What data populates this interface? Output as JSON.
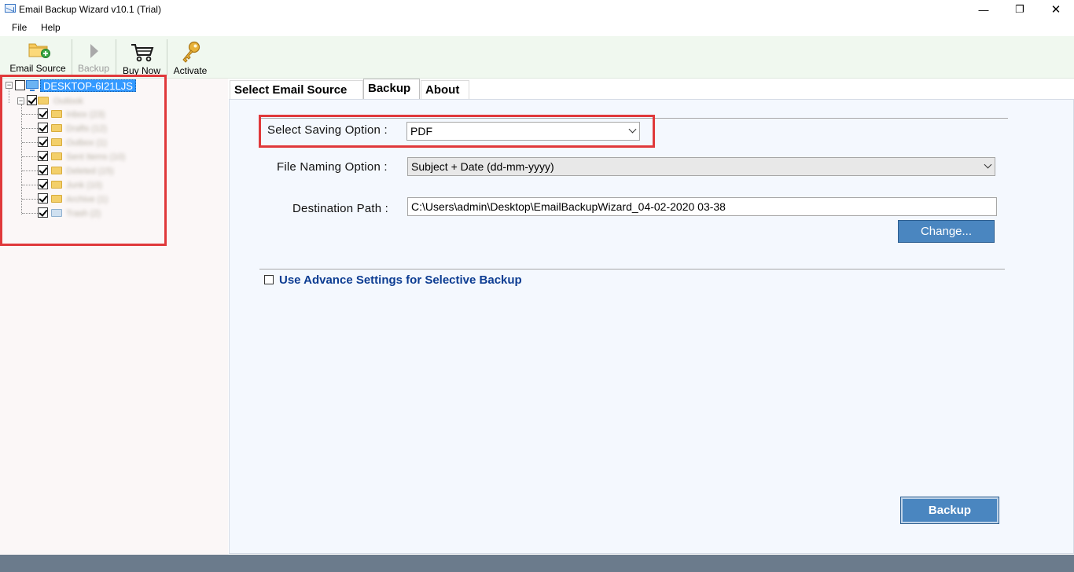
{
  "window": {
    "title": "Email Backup Wizard v10.1 (Trial)",
    "minimize": "—",
    "restore": "❐",
    "close": "✕"
  },
  "menu": {
    "file": "File",
    "help": "Help"
  },
  "toolbar": {
    "email_source": "Email Source",
    "backup": "Backup",
    "buy_now": "Buy Now",
    "activate": "Activate"
  },
  "tree": {
    "root": "DESKTOP-6I21LJS",
    "child_placeholder": "Outlook",
    "items": [
      "Inbox (23)",
      "Drafts (12)",
      "Outbox (1)",
      "Sent Items (10)",
      "Deleted (15)",
      "Junk (10)",
      "Archive (1)",
      "Trash (2)"
    ]
  },
  "tabs": {
    "select_source": "Select Email Source",
    "backup": "Backup",
    "about": "About"
  },
  "form": {
    "saving_label": "Select Saving Option :",
    "saving_value": "PDF",
    "naming_label": "File Naming Option :",
    "naming_value": "Subject + Date (dd-mm-yyyy)",
    "dest_label": "Destination Path :",
    "dest_value": "C:\\Users\\admin\\Desktop\\EmailBackupWizard_04-02-2020 03-38",
    "change_button": "Change...",
    "advance_label": "Use Advance Settings for Selective Backup",
    "advance_checked": false,
    "backup_button": "Backup"
  },
  "colors": {
    "accent_button": "#4a86c0",
    "highlight_box": "#e0393b",
    "toolbar_bg": "#f0f8ef",
    "advance_text": "#0c3c92"
  }
}
